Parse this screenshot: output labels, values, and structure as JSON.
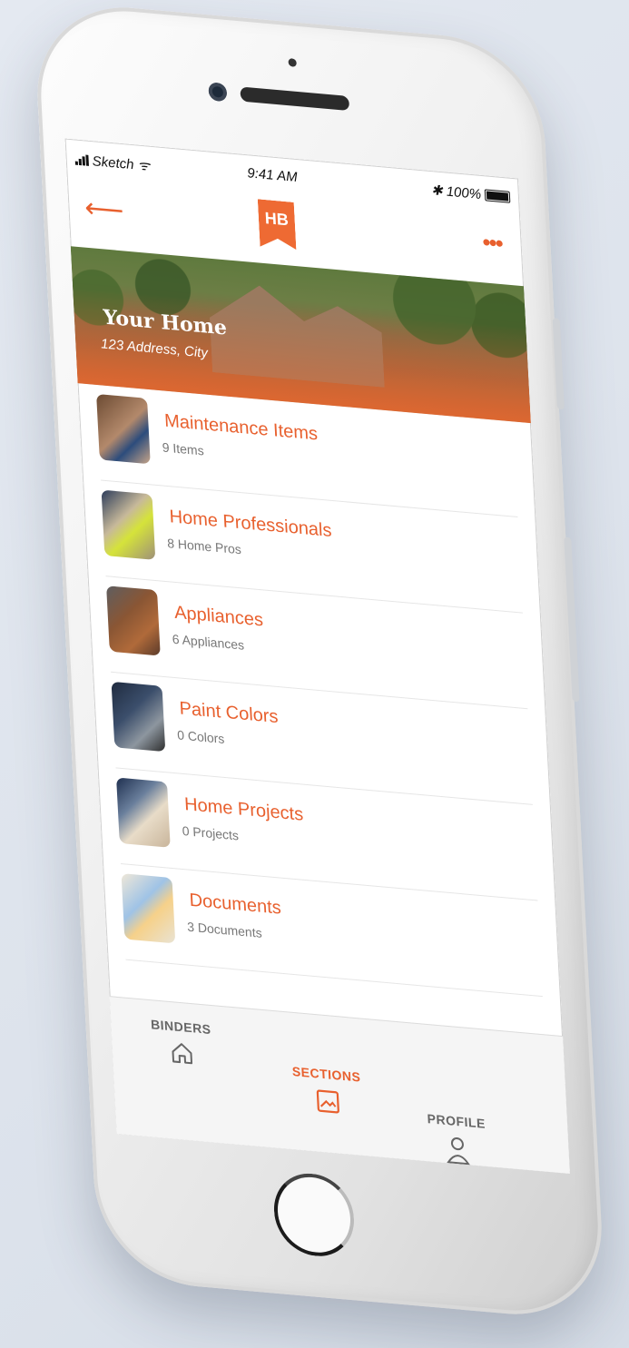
{
  "status": {
    "carrier": "Sketch",
    "time": "9:41 AM",
    "battery": "100%"
  },
  "nav": {
    "back_icon": "arrow-left-icon",
    "logo_text": "HB",
    "more_icon": "more-dots-icon"
  },
  "hero": {
    "title": "Your Home",
    "address": "123 Address, City"
  },
  "sections": [
    {
      "title": "Maintenance Items",
      "count": "9 Items"
    },
    {
      "title": "Home Professionals",
      "count": "8 Home Pros"
    },
    {
      "title": "Appliances",
      "count": "6 Appliances"
    },
    {
      "title": "Paint Colors",
      "count": "0 Colors"
    },
    {
      "title": "Home Projects",
      "count": "0 Projects"
    },
    {
      "title": "Documents",
      "count": "3 Documents"
    }
  ],
  "tabs": {
    "binders": "BINDERS",
    "sections": "SECTIONS",
    "profile": "PROFILE"
  },
  "colors": {
    "accent": "#e8602e",
    "logo": "#ee6a33"
  }
}
